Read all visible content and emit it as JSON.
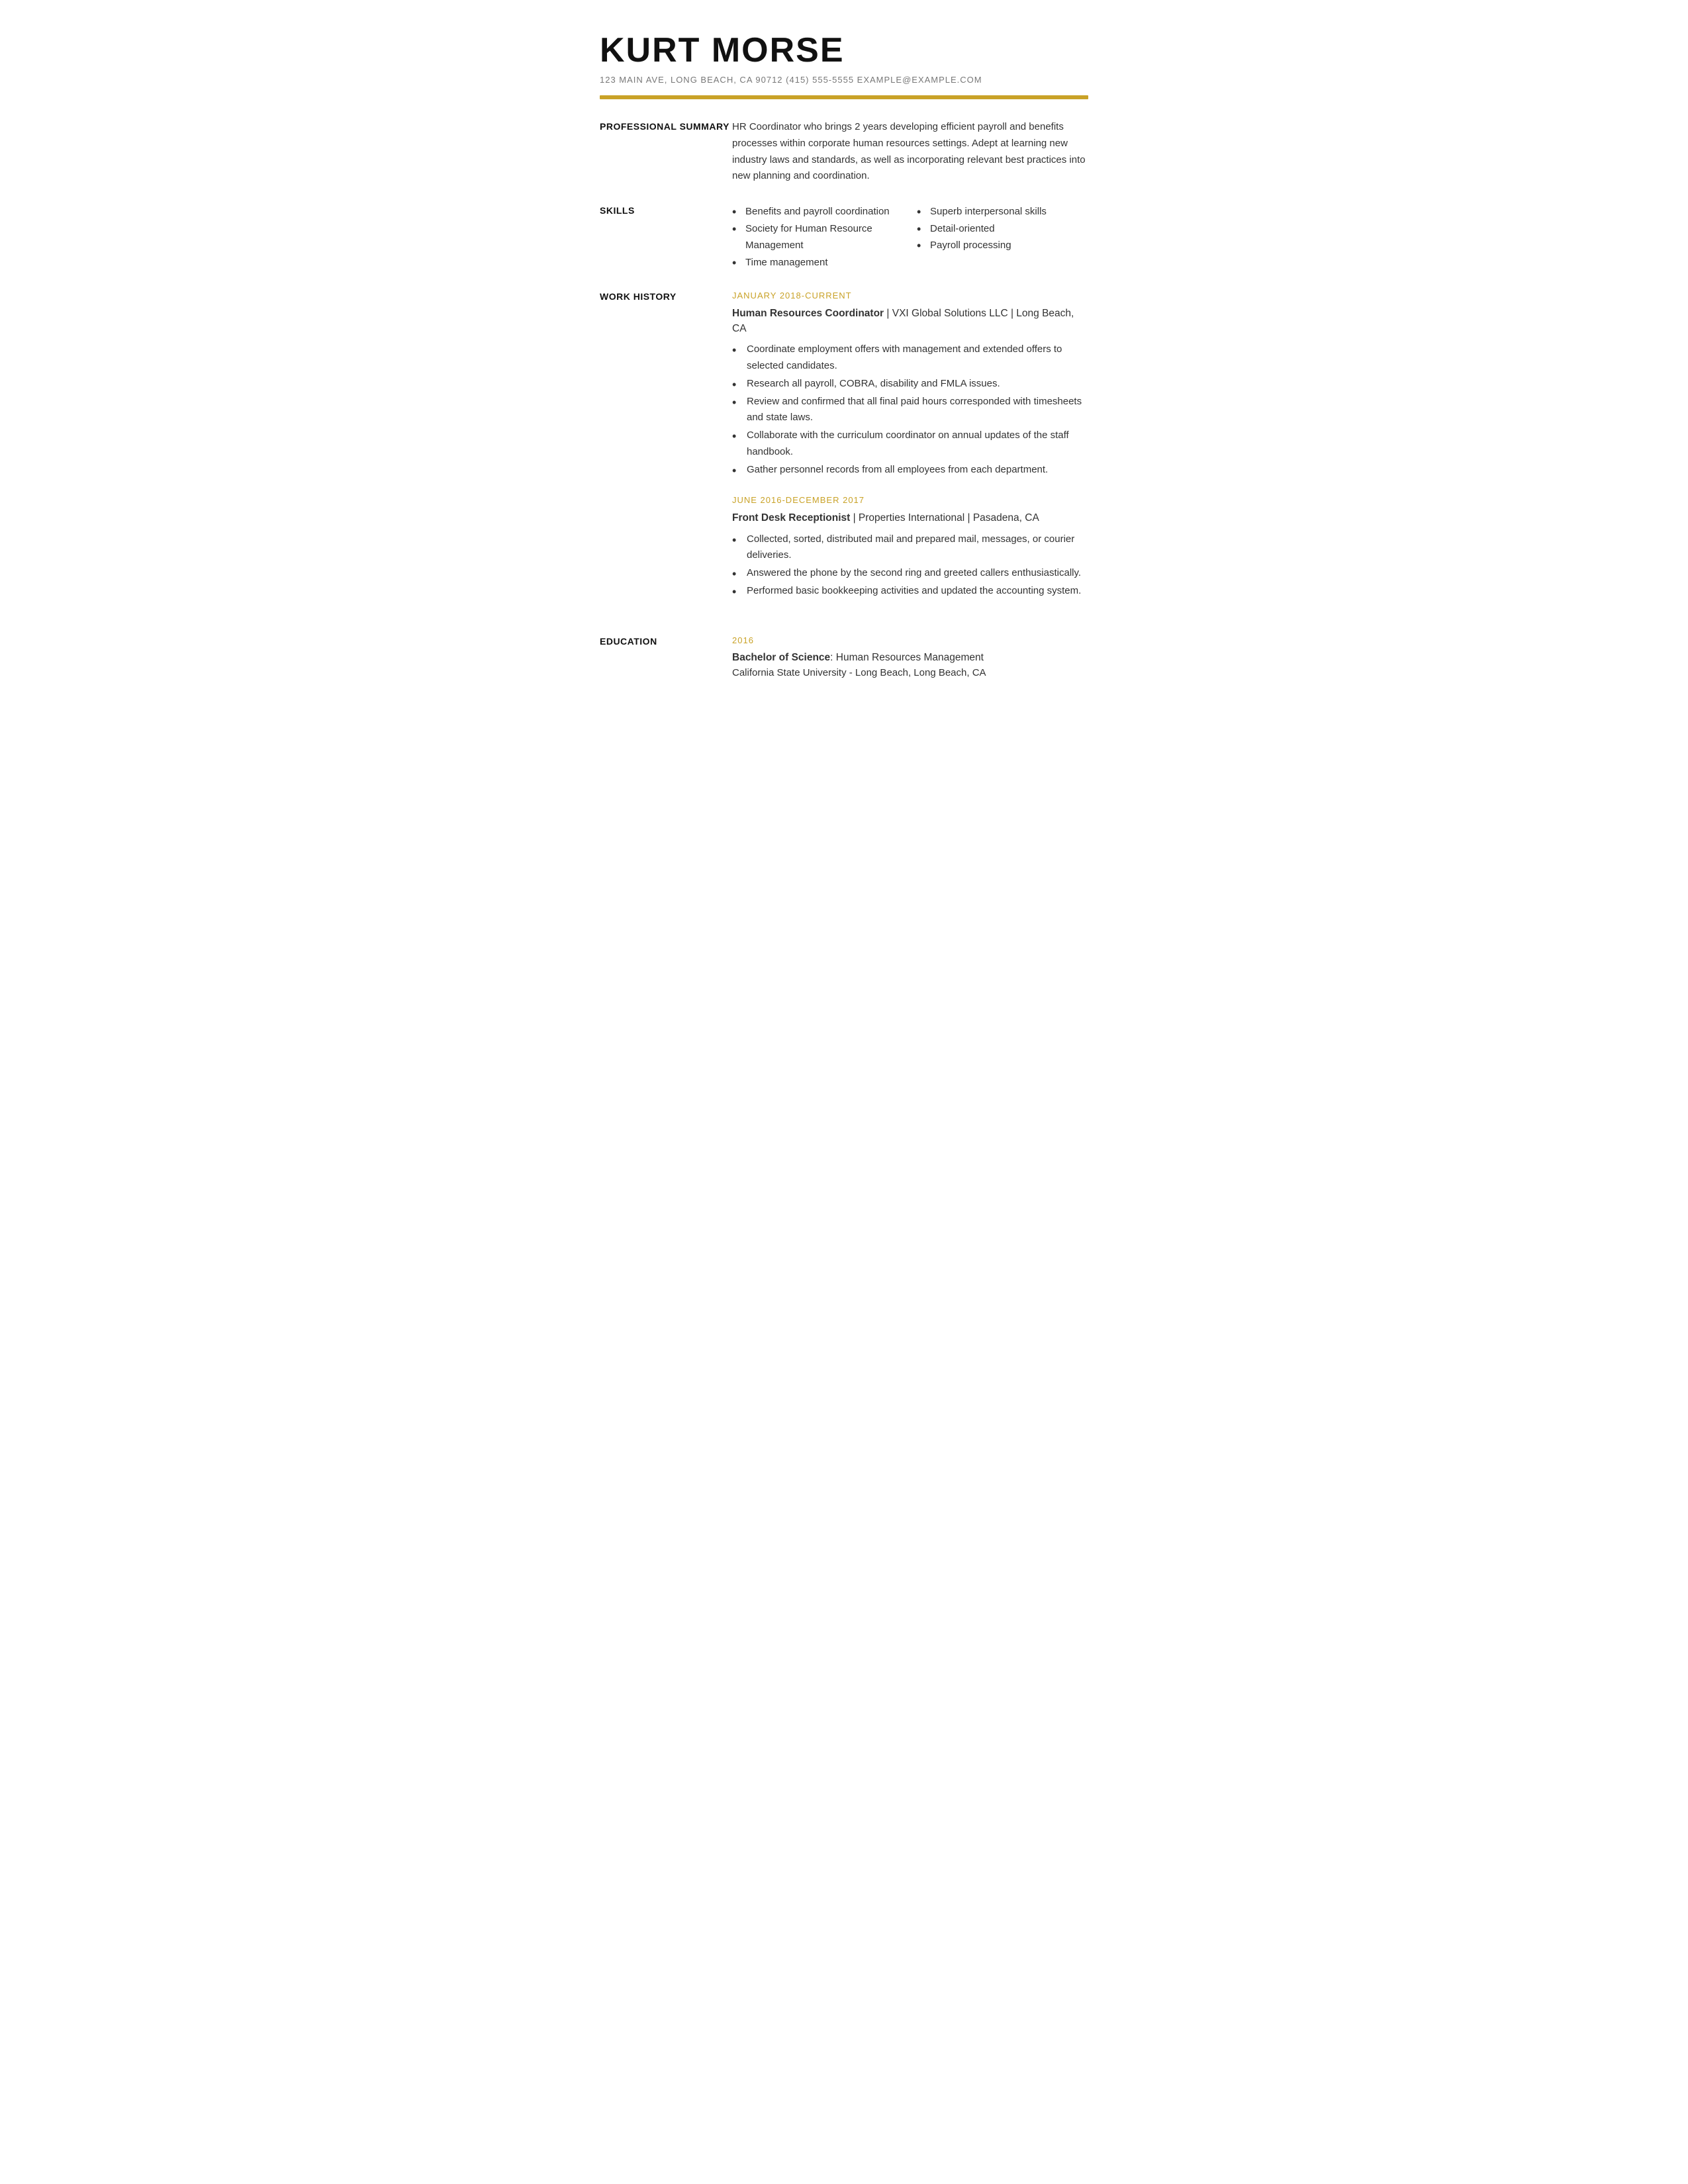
{
  "header": {
    "name": "KURT MORSE",
    "contact": "123 MAIN AVE, LONG BEACH, CA 90712  (415) 555-5555  EXAMPLE@EXAMPLE.COM"
  },
  "sections": {
    "professional_summary": {
      "label": "PROFESSIONAL SUMMARY",
      "text": "HR Coordinator who brings 2 years developing efficient payroll and benefits processes within corporate human resources settings. Adept at learning new industry laws and standards, as well as incorporating relevant best practices into new planning and coordination."
    },
    "skills": {
      "label": "SKILLS",
      "col1": [
        "Benefits and payroll coordination",
        "Society for Human Resource Management",
        "Time management"
      ],
      "col2": [
        "Superb interpersonal skills",
        "Detail-oriented",
        "Payroll processing"
      ]
    },
    "work_history": {
      "label": "WORK HISTORY",
      "jobs": [
        {
          "date": "JANUARY 2018-CURRENT",
          "title": "Human Resources Coordinator",
          "company": "VXI Global Solutions LLC | Long Beach, CA",
          "bullets": [
            "Coordinate employment offers with management and extended offers to selected candidates.",
            "Research all payroll, COBRA, disability and FMLA issues.",
            "Review and confirmed that all final paid hours corresponded with timesheets and state laws.",
            "Collaborate with the curriculum coordinator on annual updates of the staff handbook.",
            "Gather personnel records from all employees from each department."
          ]
        },
        {
          "date": "JUNE 2016-DECEMBER 2017",
          "title": "Front Desk Receptionist",
          "company": "Properties International | Pasadena, CA",
          "bullets": [
            "Collected, sorted, distributed mail and prepared mail, messages, or courier deliveries.",
            "Answered the phone by the second ring and greeted callers enthusiastically.",
            "Performed basic bookkeeping activities and updated the accounting system."
          ]
        }
      ]
    },
    "education": {
      "label": "EDUCATION",
      "year": "2016",
      "degree": "Bachelor of Science",
      "field": ": Human Resources Management",
      "school": "California State University - Long Beach, Long Beach, CA"
    }
  }
}
